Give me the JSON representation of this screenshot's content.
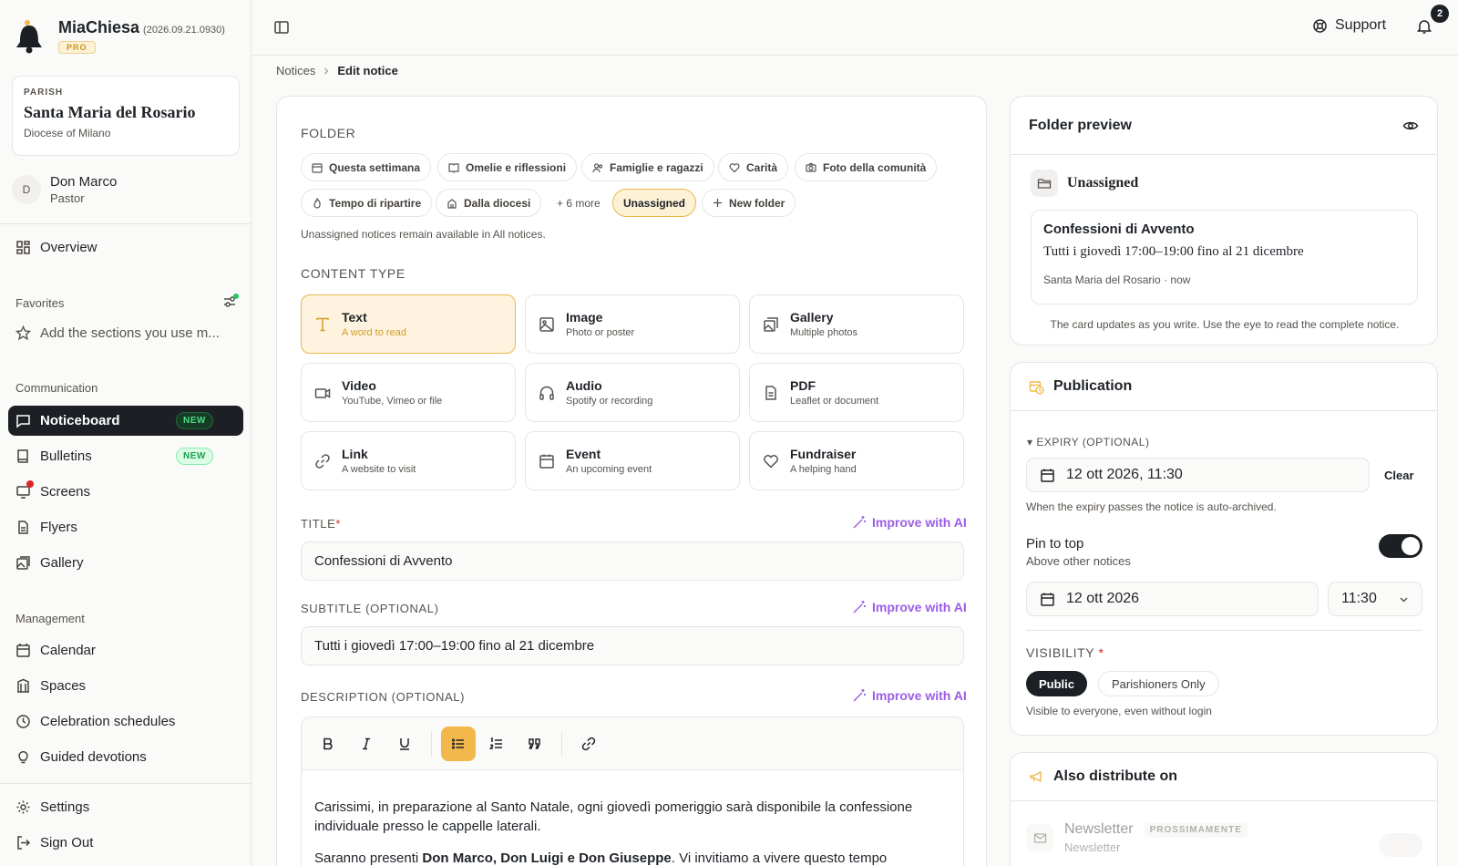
{
  "app": {
    "name": "MiaChiesa",
    "version": "(2026.09.21.0930)",
    "plan": "PRO"
  },
  "parish": {
    "label": "PARISH",
    "name": "Santa Maria del Rosario",
    "diocese": "Diocese of Milano"
  },
  "user": {
    "initial": "D",
    "name": "Don Marco",
    "role": "Pastor"
  },
  "sidebar": {
    "overview": "Overview",
    "favorites_label": "Favorites",
    "favorites_hint": "Add the sections you use m...",
    "communication_label": "Communication",
    "communication": [
      {
        "label": "Noticeboard",
        "badge": "NEW"
      },
      {
        "label": "Bulletins",
        "badge": "NEW"
      },
      {
        "label": "Screens"
      },
      {
        "label": "Flyers"
      },
      {
        "label": "Gallery"
      }
    ],
    "management_label": "Management",
    "management": [
      {
        "label": "Calendar"
      },
      {
        "label": "Spaces"
      },
      {
        "label": "Celebration schedules"
      },
      {
        "label": "Guided devotions"
      }
    ],
    "settings": "Settings",
    "signout": "Sign Out"
  },
  "topbar": {
    "support": "Support",
    "notifications_count": "2"
  },
  "breadcrumb": {
    "parent": "Notices",
    "current": "Edit notice"
  },
  "form": {
    "folder_label": "FOLDER",
    "folders": [
      "Questa settimana",
      "Omelie e riflessioni",
      "Famiglie e ragazzi",
      "Carità",
      "Foto della comunità",
      "Tempo di ripartire",
      "Dalla diocesi"
    ],
    "more_folders": "+ 6 more",
    "selected_folder": "Unassigned",
    "new_folder": "New folder",
    "folder_hint": "Unassigned notices remain available in All notices.",
    "content_type_label": "CONTENT TYPE",
    "content_types": [
      {
        "title": "Text",
        "desc": "A word to read"
      },
      {
        "title": "Image",
        "desc": "Photo or poster"
      },
      {
        "title": "Gallery",
        "desc": "Multiple photos"
      },
      {
        "title": "Video",
        "desc": "YouTube, Vimeo or file"
      },
      {
        "title": "Audio",
        "desc": "Spotify or recording"
      },
      {
        "title": "PDF",
        "desc": "Leaflet or document"
      },
      {
        "title": "Link",
        "desc": "A website to visit"
      },
      {
        "title": "Event",
        "desc": "An upcoming event"
      },
      {
        "title": "Fundraiser",
        "desc": "A helping hand"
      }
    ],
    "title_label": "TITLE",
    "required_mark": "*",
    "improve_ai": "Improve with AI",
    "title_value": "Confessioni di Avvento",
    "subtitle_label": "SUBTITLE (OPTIONAL)",
    "subtitle_value": "Tutti i giovedì 17:00–19:00 fino al 21 dicembre",
    "description_label": "DESCRIPTION (OPTIONAL)",
    "description_p1": "Carissimi, in preparazione al Santo Natale, ogni giovedì pomeriggio sarà disponibile la confessione individuale presso le cappelle laterali.",
    "description_p2_start": "Saranno presenti ",
    "description_p2_bold": "Don Marco, Don Luigi e Don Giuseppe",
    "description_p2_end": ". Vi invitiamo a vivere questo tempo"
  },
  "preview": {
    "title": "Folder preview",
    "folder": "Unassigned",
    "card_title": "Confessioni di Avvento",
    "card_subtitle": "Tutti i giovedì 17:00–19:00 fino al 21 dicembre",
    "card_meta": "Santa Maria del Rosario · now",
    "hint": "The card updates as you write. Use the eye to read the complete notice."
  },
  "publication": {
    "title": "Publication",
    "expiry_label": "▾ EXPIRY (OPTIONAL)",
    "expiry_value": "12 ott 2026, 11:30",
    "clear": "Clear",
    "expiry_hint": "When the expiry passes the notice is auto-archived.",
    "pin_title": "Pin to top",
    "pin_desc": "Above other notices",
    "pin_on": true,
    "pin_date": "12 ott 2026",
    "pin_time": "11:30",
    "visibility_label": "VISIBILITY",
    "visibility_options": [
      "Public",
      "Parishioners Only"
    ],
    "visibility_hint": "Visible to everyone, even without login"
  },
  "distribute": {
    "title": "Also distribute on",
    "channel": "Newsletter",
    "channel_badge": "PROSSIMAMENTE",
    "channel_sub": "Newsletter"
  },
  "colors": {
    "accent": "#f2b84b",
    "ai": "#9b5de5",
    "dark": "#1c1f24",
    "new_badge": "#16a34a"
  }
}
